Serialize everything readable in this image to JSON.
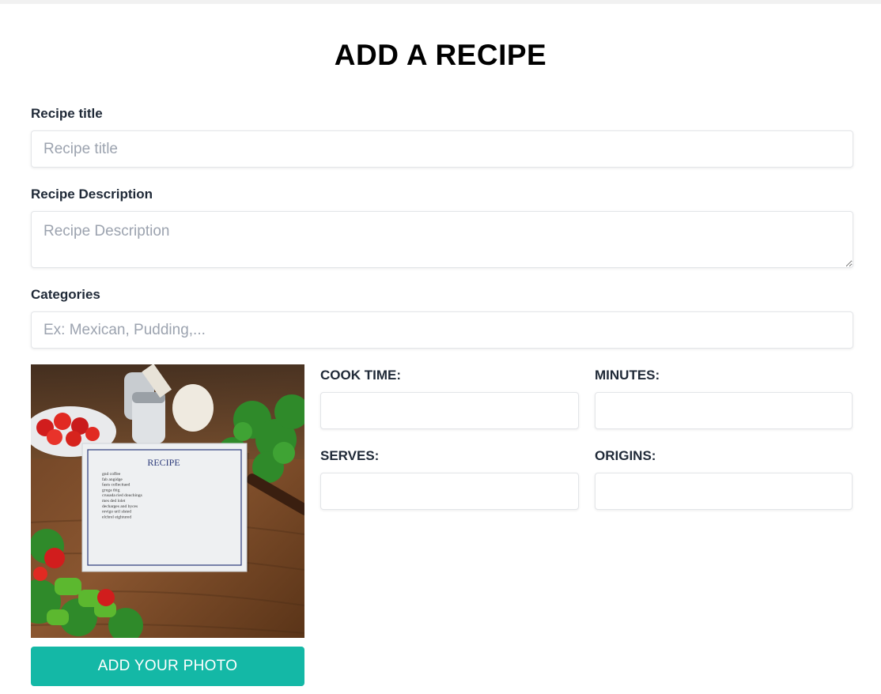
{
  "page": {
    "title": "ADD A RECIPE"
  },
  "form": {
    "recipe_title": {
      "label": "Recipe title",
      "placeholder": "Recipe title",
      "value": ""
    },
    "recipe_description": {
      "label": "Recipe Description",
      "placeholder": "Recipe Description",
      "value": ""
    },
    "categories": {
      "label": "Categories",
      "placeholder": "Ex: Mexican, Pudding,...",
      "value": ""
    },
    "cook_time": {
      "label": "COOK TIME:",
      "value": ""
    },
    "minutes": {
      "label": "MINUTES:",
      "value": ""
    },
    "serves": {
      "label": "SERVES:",
      "value": ""
    },
    "origins": {
      "label": "ORIGINS:",
      "value": ""
    }
  },
  "photo": {
    "card_heading": "RECIPE",
    "card_lines": [
      "gnd coffee",
      "fab angidge",
      "fasts collecitaed",
      "gruga thig",
      "crusada ried douchings",
      "mes ded lolet",
      "decharges and byces",
      "revigo uril slsted",
      "elchrel eightured"
    ],
    "button_label": "ADD YOUR PHOTO"
  },
  "colors": {
    "accent": "#14b8a6",
    "label": "#1f2937",
    "placeholder": "#9ca3af"
  }
}
